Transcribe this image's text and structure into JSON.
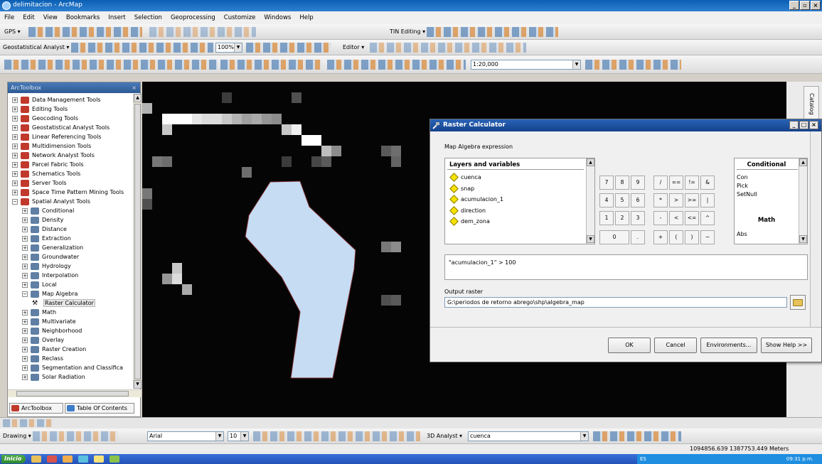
{
  "window": {
    "title": "delimitacion - ArcMap"
  },
  "menu": [
    "File",
    "Edit",
    "View",
    "Bookmarks",
    "Insert",
    "Selection",
    "Geoprocessing",
    "Customize",
    "Windows",
    "Help"
  ],
  "toolbars": {
    "gps": "GPS ▾",
    "tin_editing": "TIN Editing ▾",
    "geostatistical": "Geostatistical Analyst ▾",
    "zoom_value": "100%",
    "editor": "Editor ▾",
    "scale": "1:20,000",
    "drawing": "Drawing ▾",
    "font": "Arial",
    "font_size": "10",
    "analyst3d": "3D Analyst ▾",
    "layer": "cuenca"
  },
  "toolbox": {
    "title": "ArcToolbox",
    "items": [
      {
        "label": "Data Management Tools",
        "level": 0,
        "sign": "+"
      },
      {
        "label": "Editing Tools",
        "level": 0,
        "sign": "+"
      },
      {
        "label": "Geocoding Tools",
        "level": 0,
        "sign": "+"
      },
      {
        "label": "Geostatistical Analyst Tools",
        "level": 0,
        "sign": "+"
      },
      {
        "label": "Linear Referencing Tools",
        "level": 0,
        "sign": "+"
      },
      {
        "label": "Multidimension Tools",
        "level": 0,
        "sign": "+"
      },
      {
        "label": "Network Analyst Tools",
        "level": 0,
        "sign": "+"
      },
      {
        "label": "Parcel Fabric Tools",
        "level": 0,
        "sign": "+"
      },
      {
        "label": "Schematics Tools",
        "level": 0,
        "sign": "+"
      },
      {
        "label": "Server Tools",
        "level": 0,
        "sign": "+"
      },
      {
        "label": "Space Time Pattern Mining Tools",
        "level": 0,
        "sign": "+"
      },
      {
        "label": "Spatial Analyst Tools",
        "level": 0,
        "sign": "−"
      },
      {
        "label": "Conditional",
        "level": 1,
        "sign": "+"
      },
      {
        "label": "Density",
        "level": 1,
        "sign": "+"
      },
      {
        "label": "Distance",
        "level": 1,
        "sign": "+"
      },
      {
        "label": "Extraction",
        "level": 1,
        "sign": "+"
      },
      {
        "label": "Generalization",
        "level": 1,
        "sign": "+"
      },
      {
        "label": "Groundwater",
        "level": 1,
        "sign": "+"
      },
      {
        "label": "Hydrology",
        "level": 1,
        "sign": "+"
      },
      {
        "label": "Interpolation",
        "level": 1,
        "sign": "+"
      },
      {
        "label": "Local",
        "level": 1,
        "sign": "+"
      },
      {
        "label": "Map Algebra",
        "level": 1,
        "sign": "−"
      },
      {
        "label": "Raster Calculator",
        "level": 2,
        "sign": "",
        "selected": true
      },
      {
        "label": "Math",
        "level": 1,
        "sign": "+"
      },
      {
        "label": "Multivariate",
        "level": 1,
        "sign": "+"
      },
      {
        "label": "Neighborhood",
        "level": 1,
        "sign": "+"
      },
      {
        "label": "Overlay",
        "level": 1,
        "sign": "+"
      },
      {
        "label": "Raster Creation",
        "level": 1,
        "sign": "+"
      },
      {
        "label": "Reclass",
        "level": 1,
        "sign": "+"
      },
      {
        "label": "Segmentation and Classifica",
        "level": 1,
        "sign": "+"
      },
      {
        "label": "Solar Radiation",
        "level": 1,
        "sign": "+"
      }
    ],
    "tabs": [
      "ArcToolbox",
      "Table Of Contents"
    ]
  },
  "catalog_tab": "Catalog",
  "status": {
    "coords": "1094856.639  1387753.449 Meters"
  },
  "taskbar": {
    "start": "Inicio",
    "lang": "ES",
    "clock": "09:31 p.m."
  },
  "raster_calc": {
    "title": "Raster Calculator",
    "expr_label": "Map Algebra expression",
    "layers_header": "Layers and variables",
    "layers": [
      "cuenca",
      "snap",
      "acumulacion_1",
      "direction",
      "dem_zona"
    ],
    "keys": [
      [
        "7",
        "8",
        "9",
        "/",
        "==",
        "!=",
        "&"
      ],
      [
        "4",
        "5",
        "6",
        "*",
        ">",
        ">=",
        "|"
      ],
      [
        "1",
        "2",
        "3",
        "-",
        "<",
        "<=",
        "^"
      ],
      [
        "0",
        ".",
        "+",
        "(",
        ")",
        "~"
      ]
    ],
    "cond_header": "Conditional",
    "cond_items": [
      "Con",
      "Pick",
      "SetNull"
    ],
    "math_header": "Math",
    "math_items": [
      "Abs"
    ],
    "expression": "\"acumulacion_1\" > 100",
    "output_label": "Output raster",
    "output_value": "G:\\periodos de retorno abrego\\shp\\algebra_map",
    "buttons": {
      "ok": "OK",
      "cancel": "Cancel",
      "env": "Environments...",
      "help": "Show Help >>"
    }
  },
  "colors": {
    "title_blue": "#1f5fb0",
    "basin": "#c5dcf3",
    "selection": "#e8e8e8"
  }
}
